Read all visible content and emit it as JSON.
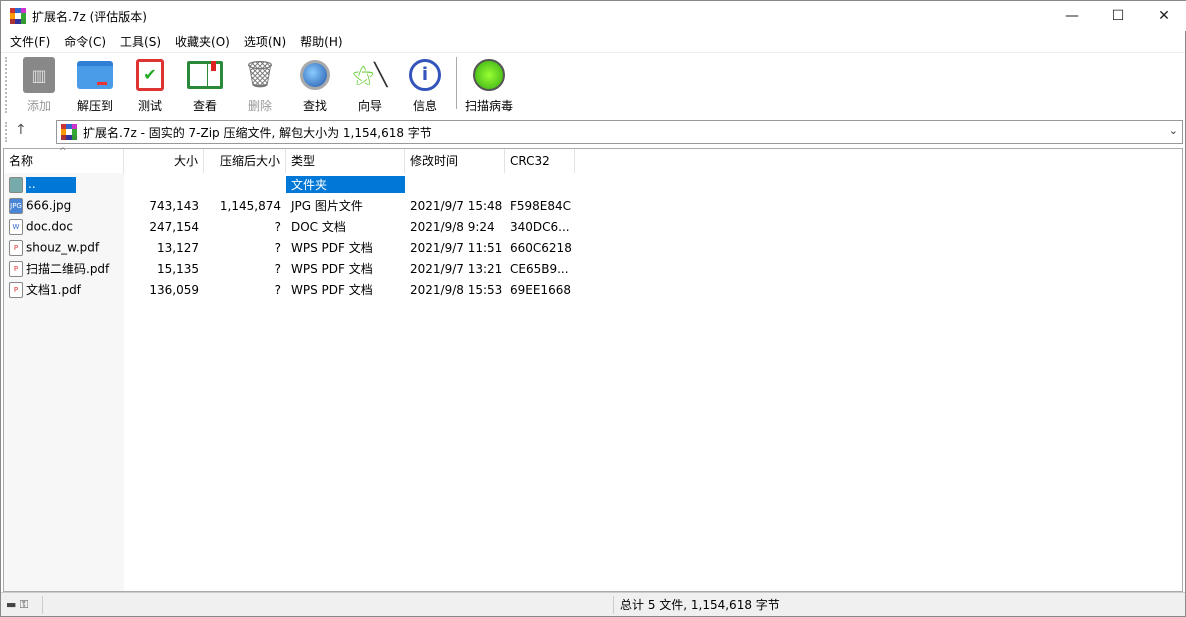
{
  "window": {
    "title": "扩展名.7z (评估版本)",
    "minimize": "—",
    "maximize": "☐",
    "close": "✕"
  },
  "menu": [
    "文件(F)",
    "命令(C)",
    "工具(S)",
    "收藏夹(O)",
    "选项(N)",
    "帮助(H)"
  ],
  "toolbar": [
    {
      "label": "添加",
      "icon": "add-archive-icon",
      "disabled": true
    },
    {
      "label": "解压到",
      "icon": "extract-folder-icon"
    },
    {
      "label": "测试",
      "icon": "test-clipboard-icon"
    },
    {
      "label": "查看",
      "icon": "view-book-icon"
    },
    {
      "label": "删除",
      "icon": "trash-icon",
      "disabled": true
    },
    {
      "label": "查找",
      "icon": "magnifier-icon"
    },
    {
      "label": "向导",
      "icon": "wizard-wand-icon"
    },
    {
      "label": "信息",
      "icon": "info-icon"
    },
    {
      "label": "扫描病毒",
      "icon": "virus-scan-icon"
    }
  ],
  "address": {
    "up": "↑",
    "text": "扩展名.7z - 固实的 7-Zip 压缩文件, 解包大小为 1,154,618 字节",
    "dropdown": "⌄"
  },
  "columns": [
    "名称",
    "大小",
    "压缩后大小",
    "类型",
    "修改时间",
    "CRC32"
  ],
  "rows": [
    {
      "name": "..",
      "size": "",
      "packed": "",
      "type": "文件夹",
      "modified": "",
      "crc": "",
      "icon": "folder",
      "selected": true
    },
    {
      "name": "666.jpg",
      "size": "743,143",
      "packed": "1,145,874",
      "type": "JPG 图片文件",
      "modified": "2021/9/7 15:48",
      "crc": "F598E84C",
      "icon": "jpg"
    },
    {
      "name": "doc.doc",
      "size": "247,154",
      "packed": "?",
      "type": "DOC 文档",
      "modified": "2021/9/8 9:24",
      "crc": "340DC6...",
      "icon": "doc"
    },
    {
      "name": "shouz_w.pdf",
      "size": "13,127",
      "packed": "?",
      "type": "WPS PDF 文档",
      "modified": "2021/9/7 11:51",
      "crc": "660C6218",
      "icon": "pdf"
    },
    {
      "name": "扫描二维码.pdf",
      "size": "15,135",
      "packed": "?",
      "type": "WPS PDF 文档",
      "modified": "2021/9/7 13:21",
      "crc": "CE65B9...",
      "icon": "pdf"
    },
    {
      "name": "文档1.pdf",
      "size": "136,059",
      "packed": "?",
      "type": "WPS PDF 文档",
      "modified": "2021/9/8 15:53",
      "crc": "69EE1668",
      "icon": "pdf"
    }
  ],
  "status": {
    "summary": "总计 5 文件, 1,154,618 字节"
  },
  "colors": {
    "selection": "#0078d7"
  }
}
